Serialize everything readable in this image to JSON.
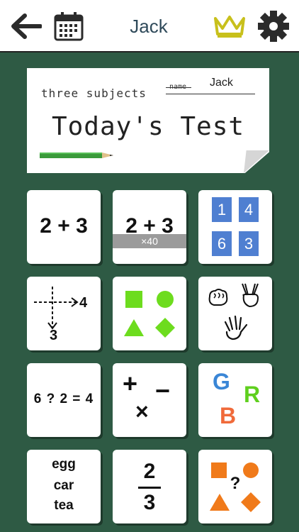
{
  "header": {
    "title": "Jack",
    "icons": [
      "back-arrow-icon",
      "calendar-icon",
      "crown-icon",
      "gear-icon"
    ],
    "colors": {
      "crown": "#c8c01c",
      "icon_dark": "#2b2b2b",
      "title": "#2f4a5a"
    }
  },
  "test_card": {
    "subject": "three subjects",
    "name_label": "name",
    "name_value": "Jack",
    "title": "Today's Test"
  },
  "tiles": {
    "t1": {
      "expr": "2 + 3"
    },
    "t2": {
      "expr": "2 + 3",
      "badge": "×40"
    },
    "t3": {
      "numbers": [
        "1",
        "4",
        "6",
        "3"
      ]
    },
    "t4": {
      "right": "4",
      "down": "3"
    },
    "t5": {
      "shapes": [
        "square",
        "circle",
        "triangle",
        "diamond"
      ],
      "color": "#6ddc1e"
    },
    "t6": {
      "icons": [
        "rock-hand-icon",
        "peace-hand-icon",
        "paper-hand-icon"
      ]
    },
    "t7": {
      "expr": "6 ? 2 = 4"
    },
    "t8": {
      "ops": [
        "+",
        "−",
        "×"
      ]
    },
    "t9": {
      "letters": [
        "G",
        "R",
        "B"
      ],
      "colors": [
        "#3a86d6",
        "#5fcf1e",
        "#f06a3a"
      ]
    },
    "t10": {
      "words": [
        "egg",
        "car",
        "tea"
      ]
    },
    "t11": {
      "numerator": "2",
      "denominator": "3"
    },
    "t12": {
      "mark": "?",
      "color": "#f07a1a"
    }
  },
  "colors": {
    "background": "#2e5a44",
    "tile": "#ffffff",
    "blue": "#4f7fd1"
  }
}
